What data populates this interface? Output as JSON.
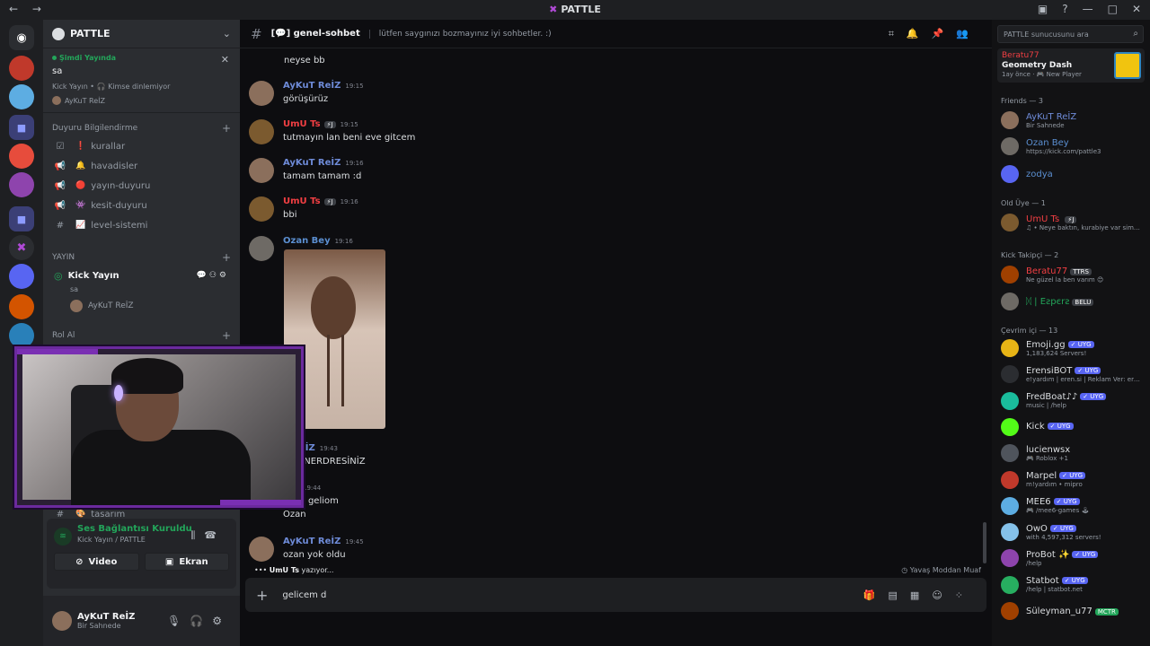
{
  "window": {
    "title": "PATTLE",
    "nav": "← →",
    "controls": [
      "▣",
      "?",
      "—",
      "□",
      "✕"
    ]
  },
  "rail": {
    "servers": [
      "discord-home",
      "server-1",
      "server-2",
      "folder",
      "server-3",
      "server-4",
      "folder-2",
      "pattle",
      "server-5",
      "server-6",
      "server-7"
    ]
  },
  "sidebar": {
    "server_name": "PATTLE",
    "live": {
      "label": "Şimdi Yayında",
      "title": "sa",
      "sub": "Kick Yayın • 🎧 Kimse dinlemiyor",
      "user": "AyKuT ReİZ"
    },
    "categories": [
      {
        "name": "Duyuru Bilgilendirme",
        "channels": [
          {
            "icon": "☑",
            "emoji": "❗",
            "name": "kurallar"
          },
          {
            "icon": "📢",
            "emoji": "🔔",
            "name": "havadisler"
          },
          {
            "icon": "📢",
            "emoji": "🔴",
            "name": "yayın-duyuru"
          },
          {
            "icon": "📢",
            "emoji": "👾",
            "name": "kesit-duyuru"
          },
          {
            "icon": "#",
            "emoji": "📈",
            "name": "level-sistemi"
          }
        ]
      },
      {
        "name": "YAYIN"
      },
      {
        "name": "Rol Al"
      }
    ],
    "voice": {
      "name": "Kick Yayın",
      "sub": "sa",
      "user": "AyKuT ReİZ"
    },
    "tasarim": "tasarım",
    "voice_panel": {
      "status": "Ses Bağlantısı Kuruldu",
      "sub": "Kick Yayın / PATTLE",
      "video": "Video",
      "screen": "Ekran"
    },
    "user": {
      "name": "AyKuT ReİZ",
      "status": "Bir Sahnede"
    }
  },
  "chat": {
    "channel": "[💬] genel-sohbet",
    "topic": "lütfen saygınızı bozmayınız iyi sohbetler. :)",
    "messages": [
      {
        "text": "neyse bb"
      },
      {
        "author": "AyKuT ReİZ",
        "time": "19:15",
        "text": "görüşürüz"
      },
      {
        "author": "UmU Ts",
        "badge": "⚡J",
        "time": "19:15",
        "text": "tutmayın lan beni eve gitcem"
      },
      {
        "author": "AyKuT ReİZ",
        "time": "19:16",
        "text": "tamam tamam :d"
      },
      {
        "author": "UmU Ts",
        "badge": "⚡J",
        "time": "19:16",
        "text": "bbi"
      },
      {
        "author": "Ozan Bey",
        "time": "19:16"
      },
      {
        "author": "T ReİZ",
        "time": "19:43",
        "text": "LAN NERDRESİNİZ"
      },
      {
        "author": "",
        "badge": "⚡J",
        "time": "19:44",
        "text": "n len geliom",
        "text2": "Ozan"
      },
      {
        "author": "AyKuT ReİZ",
        "time": "19:45",
        "text": "ozan yok oldu"
      }
    ],
    "typing_user": "UmU Ts",
    "typing_text": "yazıyor...",
    "slowmode": "Yavaş Moddan Muaf",
    "composer_value": "gelicem d"
  },
  "members": {
    "search_placeholder": "PATTLE sunucusunu ara",
    "activity": {
      "user": "Beratu77",
      "game": "Geometry Dash",
      "meta": "1ay önce · 🎮 New Player"
    },
    "friends_label": "Friends — 3",
    "friends": [
      {
        "name": "AyKuT ReİZ",
        "sub": "Bir Sahnede",
        "color": "#6e8bd8"
      },
      {
        "name": "Ozan Bey",
        "sub": "https://kick.com/pattle3",
        "color": "#5b8fd1"
      },
      {
        "name": "zodya",
        "sub": "",
        "color": "#5b8fd1"
      }
    ],
    "old_label": "Old Üye — 1",
    "old": [
      {
        "name": "UmU Ts",
        "badge": "⚡J",
        "sub": "♫ • Neye baktın, kurabiye var simi...",
        "color": "#f23f43"
      }
    ],
    "kick_label": "Kick Takipçi — 2",
    "kick": [
      {
        "name": "Beratu77",
        "tag": "TTRS",
        "sub": "Ne güzel la ben varım 😊",
        "color": "#f23f43"
      },
      {
        "name": "ᛞ | Eƨpєrƨ",
        "tag": "BELU",
        "sub": "",
        "color": "#23a55a"
      }
    ],
    "online_label": "Çevrim içi — 13",
    "online": [
      {
        "name": "Emoji.gg",
        "sub": "1,183,624 Servers!",
        "av": "#e7b416"
      },
      {
        "name": "ErensiBOT",
        "sub": "e!yardım | eren.si | Reklam Ver: ere...",
        "av": "#2b2d31"
      },
      {
        "name": "FredBoat♪♪",
        "sub": "music | /help",
        "av": "#1abc9c"
      },
      {
        "name": "Kick",
        "sub": "",
        "av": "#53fc18"
      },
      {
        "name": "lucienwsx",
        "sub": "🎮 Roblox +1",
        "badge_none": true,
        "av": "#4f545c"
      },
      {
        "name": "Marpel",
        "sub": "m!yardım • mipro",
        "av": "#c0392b"
      },
      {
        "name": "MEE6",
        "sub": "🎮 /mee6-games 🕹",
        "av": "#5dade2"
      },
      {
        "name": "OwO",
        "sub": "with 4,597,312 servers!",
        "av": "#85c1e9"
      },
      {
        "name": "ProBot ✨",
        "sub": "/help",
        "av": "#8e44ad"
      },
      {
        "name": "Statbot",
        "sub": "/help | statbot.net",
        "av": "#27ae60"
      },
      {
        "name": "Süleyman_u77",
        "tag": "MCTR",
        "sub": "",
        "av": "#a04000"
      }
    ],
    "uyg": "✓ UYG"
  }
}
